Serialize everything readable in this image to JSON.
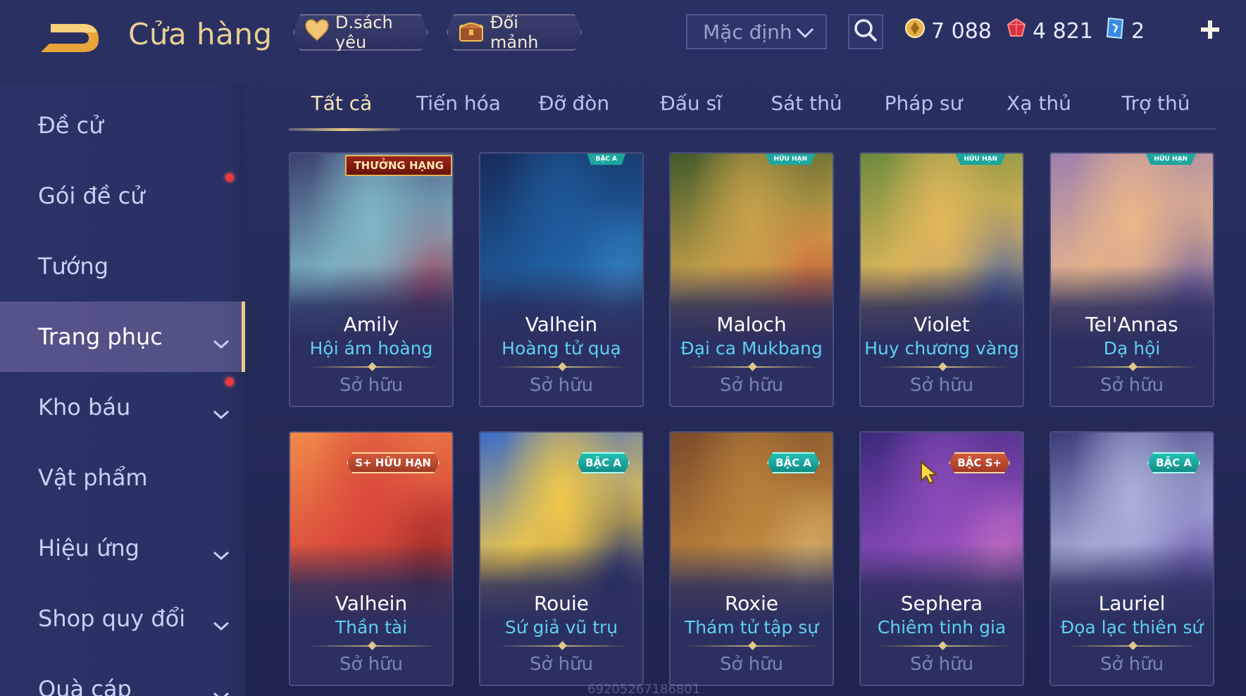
{
  "header": {
    "title": "Cửa hàng",
    "favorites_label": "D.sách yêu",
    "exchange_label": "Đổi mảnh",
    "sort_value": "Mặc định"
  },
  "currency": {
    "gold": "7 088",
    "ruby": "4 821",
    "gem": "2"
  },
  "sidebar": {
    "items": [
      {
        "label": "Đề cử",
        "chevron": false,
        "dot": false
      },
      {
        "label": "Gói đề cử",
        "chevron": false,
        "dot": true
      },
      {
        "label": "Tướng",
        "chevron": false,
        "dot": false
      },
      {
        "label": "Trang phục",
        "chevron": true,
        "dot": false,
        "active": true
      },
      {
        "label": "Kho báu",
        "chevron": true,
        "dot": true
      },
      {
        "label": "Vật phẩm",
        "chevron": false,
        "dot": false
      },
      {
        "label": "Hiệu ứng",
        "chevron": true,
        "dot": false
      },
      {
        "label": "Shop quy đổi",
        "chevron": true,
        "dot": false
      },
      {
        "label": "Quà cáp",
        "chevron": true,
        "dot": false
      }
    ]
  },
  "tabs": [
    {
      "label": "Tất cả",
      "active": true
    },
    {
      "label": "Tiến hóa"
    },
    {
      "label": "Đỡ đòn"
    },
    {
      "label": "Đấu sĩ"
    },
    {
      "label": "Sát thủ"
    },
    {
      "label": "Pháp sư"
    },
    {
      "label": "Xạ thủ"
    },
    {
      "label": "Trợ thủ"
    }
  ],
  "cards": [
    {
      "hero": "Amily",
      "skin": "Hội ám hoàng",
      "status": "Sở hữu",
      "badge": "THƯỞNG HẠNG",
      "colors": [
        "#7fb7c6",
        "#3b3f6d",
        "#a43c55"
      ]
    },
    {
      "hero": "Valhein",
      "skin": "Hoàng tử quạ",
      "status": "Sở hữu",
      "badge": "BẬC A",
      "colors": [
        "#1d5b9a",
        "#172b5a",
        "#3d8fcf"
      ]
    },
    {
      "hero": "Maloch",
      "skin": "Đại ca Mukbang",
      "status": "Sở hữu",
      "badge": "HỮU HẠN",
      "colors": [
        "#c9a24a",
        "#3f5a2a",
        "#d8603a"
      ]
    },
    {
      "hero": "Violet",
      "skin": "Huy chương vàng",
      "status": "Sở hữu",
      "badge": "HỮU HẠN",
      "colors": [
        "#e2b85a",
        "#6c8a3e",
        "#3f5aa8"
      ]
    },
    {
      "hero": "Tel'Annas",
      "skin": "Dạ hội",
      "status": "Sở hữu",
      "badge": "HỮU HẠN",
      "colors": [
        "#e8b68a",
        "#9c7fae",
        "#6a5aa0"
      ]
    },
    {
      "hero": "Valhein",
      "skin": "Thần tài",
      "status": "Sở hữu",
      "badge": "S+ HỮU HẠN",
      "colors": [
        "#d94a3a",
        "#f08a4a",
        "#8a1e24"
      ]
    },
    {
      "hero": "Rouie",
      "skin": "Sứ giả vũ trụ",
      "status": "Sở hữu",
      "badge": "BẬC A",
      "colors": [
        "#f0c84a",
        "#3a6ac8",
        "#1d2a6a"
      ]
    },
    {
      "hero": "Roxie",
      "skin": "Thám tử tập sự",
      "status": "Sở hữu",
      "badge": "BẬC A",
      "colors": [
        "#b8803a",
        "#7a4a2a",
        "#e0c07a"
      ]
    },
    {
      "hero": "Sephera",
      "skin": "Chiêm tinh gia",
      "status": "Sở hữu",
      "badge": "BẬC S+",
      "colors": [
        "#8a4ab8",
        "#3a2a7a",
        "#d87ac8"
      ]
    },
    {
      "hero": "Lauriel",
      "skin": "Đọa lạc thiên sứ",
      "status": "Sở hữu",
      "badge": "BẬC A",
      "colors": [
        "#aab0d8",
        "#3a3a7a",
        "#6a5ab0"
      ]
    }
  ],
  "watermark": "69205267186801"
}
